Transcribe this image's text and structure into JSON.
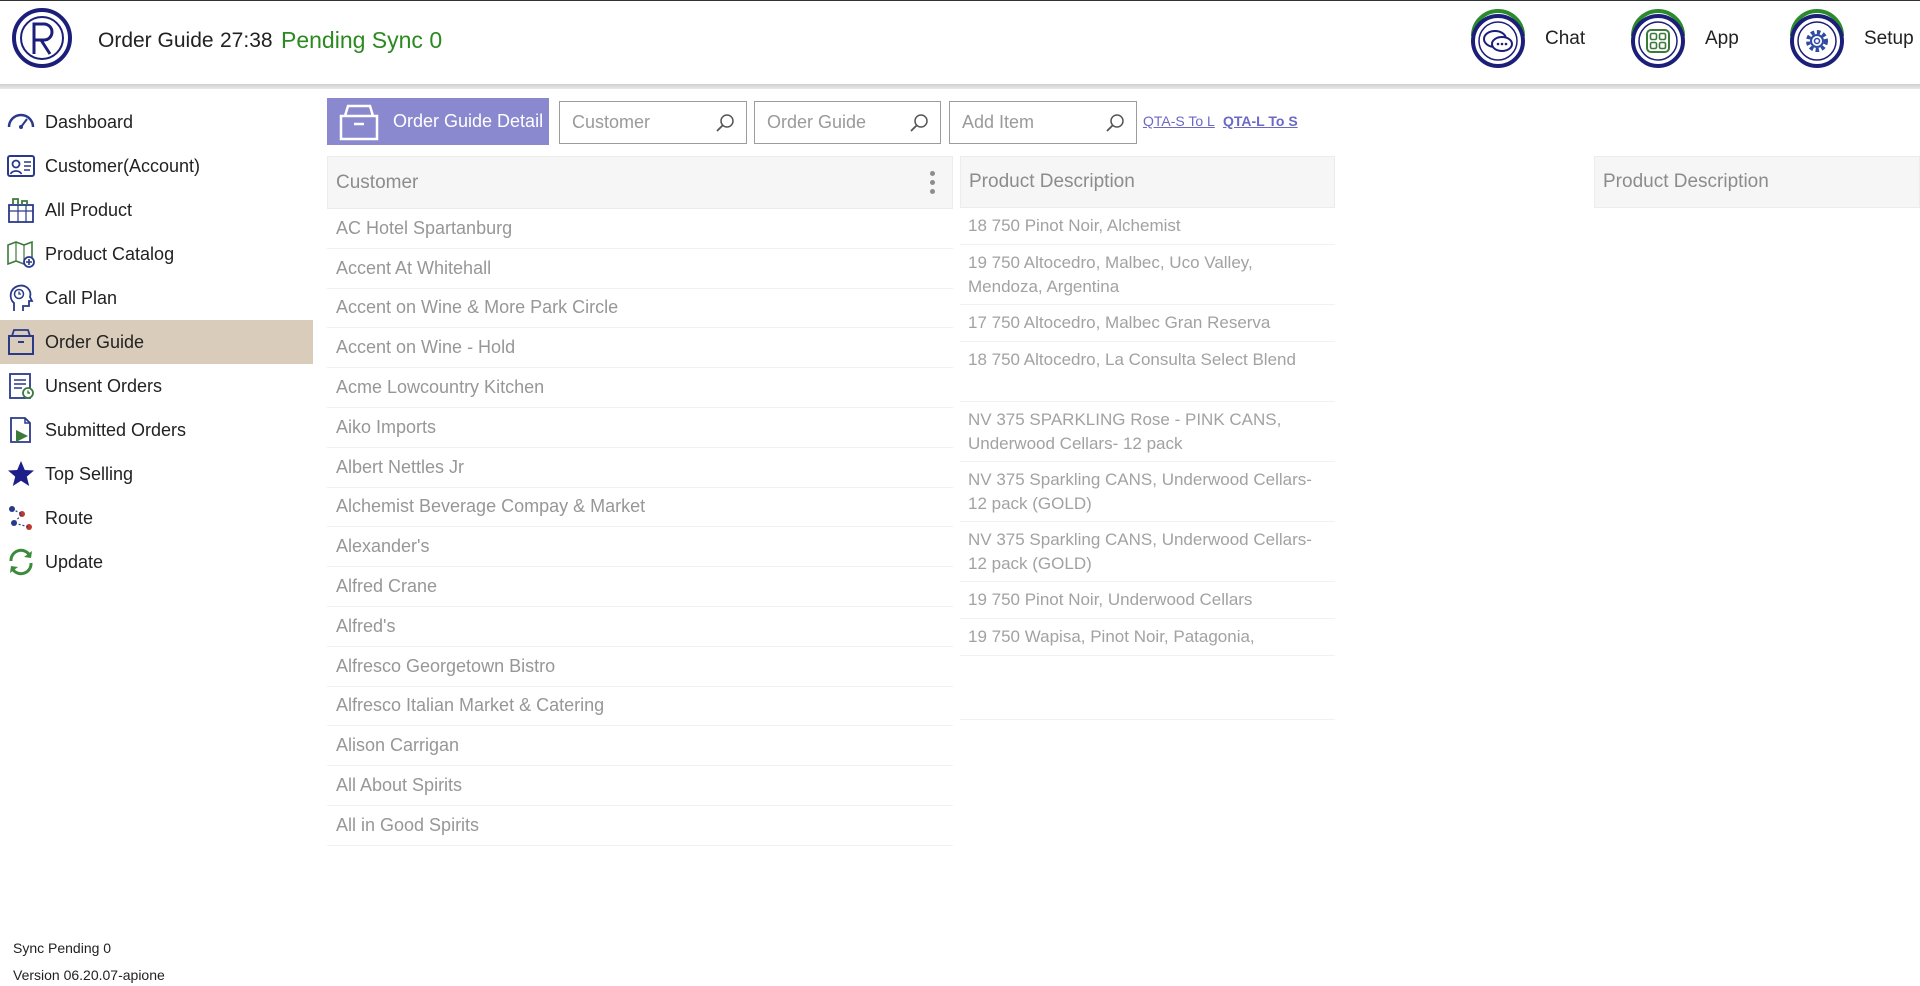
{
  "header": {
    "title": "Order Guide",
    "time": "27:38",
    "sync_status": "Pending Sync 0",
    "buttons": [
      {
        "label": "Chat",
        "icon": "chat-icon"
      },
      {
        "label": "App",
        "icon": "app-grid-icon"
      },
      {
        "label": "Setup",
        "icon": "gear-icon"
      }
    ]
  },
  "sidebar": {
    "items": [
      {
        "label": "Dashboard",
        "icon": "dashboard-icon"
      },
      {
        "label": "Customer(Account)",
        "icon": "customer-account-icon"
      },
      {
        "label": "All Product",
        "icon": "all-product-icon"
      },
      {
        "label": "Product Catalog",
        "icon": "product-catalog-icon"
      },
      {
        "label": "Call Plan",
        "icon": "call-plan-icon"
      },
      {
        "label": "Order Guide",
        "icon": "order-guide-icon",
        "active": true
      },
      {
        "label": "Unsent Orders",
        "icon": "unsent-orders-icon"
      },
      {
        "label": "Submitted Orders",
        "icon": "submitted-orders-icon"
      },
      {
        "label": "Top Selling",
        "icon": "star-icon"
      },
      {
        "label": "Route",
        "icon": "route-icon"
      },
      {
        "label": "Update",
        "icon": "refresh-icon"
      }
    ],
    "footer": {
      "sync_pending": "Sync Pending 0",
      "version": "Version 06.20.07-apione"
    }
  },
  "toolbar": {
    "order_guide_detail_label": "Order Guide Detail",
    "customer_search_placeholder": "Customer",
    "order_guide_search_placeholder": "Order Guide",
    "add_item_placeholder": "Add Item",
    "qta_s_to_l": "QTA-S To L",
    "qta_l_to_s": "QTA-L To S"
  },
  "customers": {
    "header": "Customer",
    "rows": [
      "AC Hotel Spartanburg",
      "Accent At Whitehall",
      "Accent on Wine & More Park Circle",
      "Accent on Wine - Hold",
      "Acme Lowcountry Kitchen",
      "Aiko Imports",
      "Albert Nettles Jr",
      "Alchemist Beverage Compay & Market",
      "Alexander's",
      "Alfred Crane",
      "Alfred's",
      "Alfresco Georgetown Bistro",
      "Alfresco Italian Market & Catering",
      "Alison Carrigan",
      "All About Spirits",
      "All in Good Spirits"
    ]
  },
  "products": {
    "header": "Product Description",
    "rows": [
      "18 750 Pinot Noir, Alchemist",
      "19 750 Altocedro, Malbec, Uco Valley, Mendoza, Argentina",
      "17 750 Altocedro, Malbec Gran Reserva",
      "18 750 Altocedro, La Consulta Select Blend",
      "NV 375 SPARKLING Rose - PINK CANS, Underwood Cellars- 12 pack",
      "NV 375 Sparkling CANS, Underwood Cellars- 12 pack (GOLD)",
      "NV 375 Sparkling CANS, Underwood Cellars- 12 pack (GOLD)",
      "19 750 Pinot Noir, Underwood Cellars",
      "19 750 Wapisa,  Pinot Noir, Patagonia,"
    ]
  },
  "products2": {
    "header": "Product Description"
  },
  "colors": {
    "accent": "#8a88cf",
    "active_nav": "#d9ccbb",
    "sync_green": "#2a8a1f",
    "brand_navy": "#1c1f7a",
    "link": "#6b69c4"
  }
}
